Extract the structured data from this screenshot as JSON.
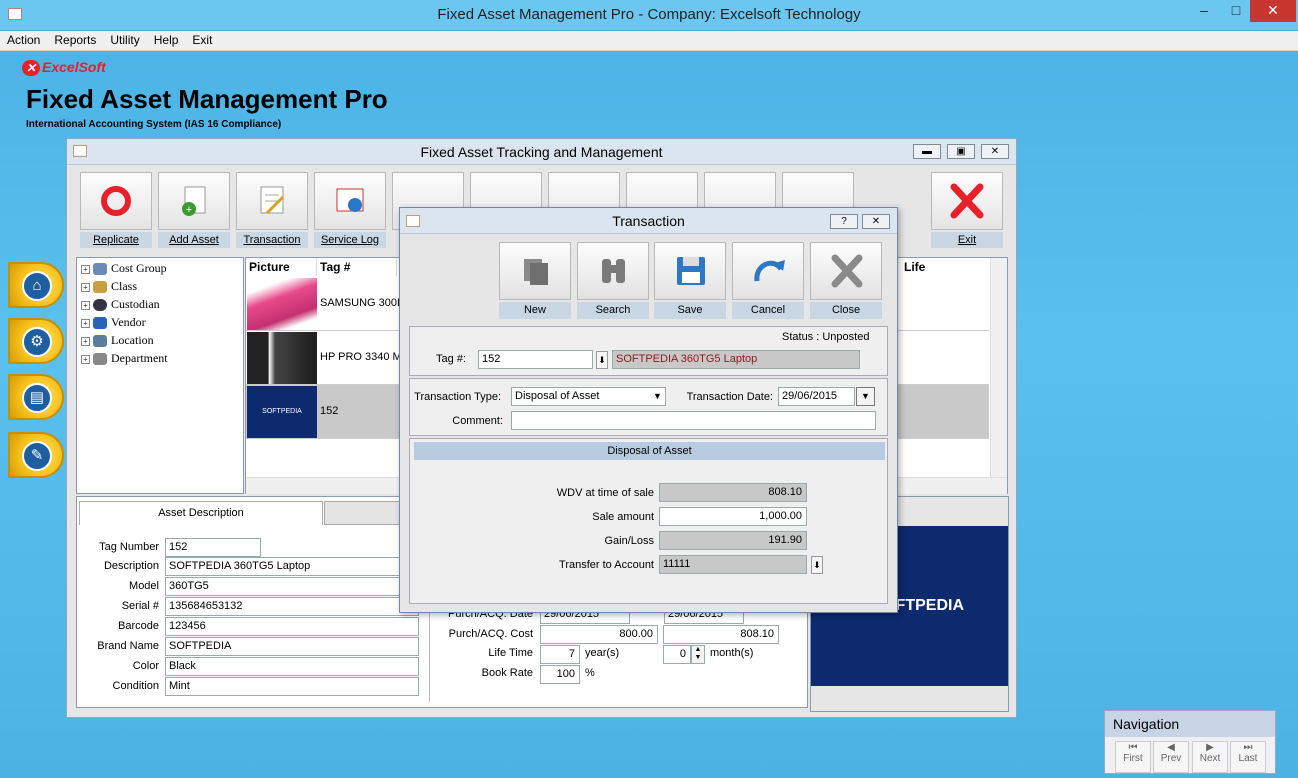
{
  "window": {
    "title": "Fixed Asset Management Pro - Company:  Excelsoft Technology"
  },
  "menu": [
    "Action",
    "Reports",
    "Utility",
    "Help",
    "Exit"
  ],
  "brand": {
    "logo": "ExcelSoft",
    "title": "Fixed Asset Management Pro",
    "subtitle": "International Accounting System (IAS 16 Compliance)"
  },
  "main": {
    "title": "Fixed Asset Tracking and Management",
    "toolbar": [
      "Replicate",
      "Add Asset",
      "Transaction",
      "Service Log",
      "",
      "",
      "",
      "",
      "",
      "",
      "Exit"
    ],
    "tree": [
      "Cost Group",
      "Class",
      "Custodian",
      "Vendor",
      "Location",
      "Department"
    ],
    "grid": {
      "headers": [
        "Picture",
        "Tag #",
        "Life"
      ],
      "rows": [
        {
          "tag": "SAMSUNG 300E"
        },
        {
          "tag": "HP PRO 3340 MT"
        },
        {
          "tag": "152",
          "pic_text": "SOFTPEDIA"
        }
      ]
    },
    "tabs": [
      "Asset Description",
      ""
    ],
    "details": {
      "labels": [
        "Tag Number",
        "Description",
        "Model",
        "Serial #",
        "Barcode",
        "Brand Name",
        "Color",
        "Condition"
      ],
      "values": [
        "152",
        "SOFTPEDIA 360TG5 Laptop",
        "360TG5",
        "135684653132",
        "123456",
        "SOFTPEDIA",
        "Black",
        "Mint"
      ]
    },
    "finance": {
      "purch_date_label": "Purch/ACQ. Date",
      "purch_date_1": "29/06/2015",
      "purch_date_2": "29/06/2015",
      "purch_cost_label": "Purch/ACQ. Cost",
      "purch_cost_1": "800.00",
      "purch_cost_2": "808.10",
      "life_label": "Life Time",
      "life_years": "7",
      "years_unit": "year(s)",
      "life_months": "0",
      "months_unit": "month(s)",
      "book_rate_label": "Book Rate",
      "book_rate": "100",
      "pct": "%"
    },
    "picture_text": "SOFTPEDIA"
  },
  "dialog": {
    "title": "Transaction",
    "buttons": [
      "New",
      "Search",
      "Save",
      "Cancel",
      "Close"
    ],
    "status": "Status : Unposted",
    "tag_label": "Tag #:",
    "tag_value": "152",
    "tag_desc": "SOFTPEDIA 360TG5 Laptop",
    "type_label": "Transaction Type:",
    "type_value": "Disposal of Asset",
    "date_label": "Transaction Date:",
    "date_value": "29/06/2015",
    "comment_label": "Comment:",
    "comment_value": "",
    "section": "Disposal of Asset",
    "wdv_label": "WDV at time of sale",
    "wdv": "808.10",
    "sale_label": "Sale amount",
    "sale": "1,000.00",
    "gain_label": "Gain/Loss",
    "gain": "191.90",
    "acct_label": "Transfer to Account",
    "acct": "11111"
  },
  "nav": {
    "title": "Navigation",
    "buttons": [
      "First",
      "Prev",
      "Next",
      "Last"
    ]
  },
  "colors": {
    "desktop": "#5fbfea",
    "accent": "#c9d6e4",
    "exit_red": "#e8202a"
  }
}
